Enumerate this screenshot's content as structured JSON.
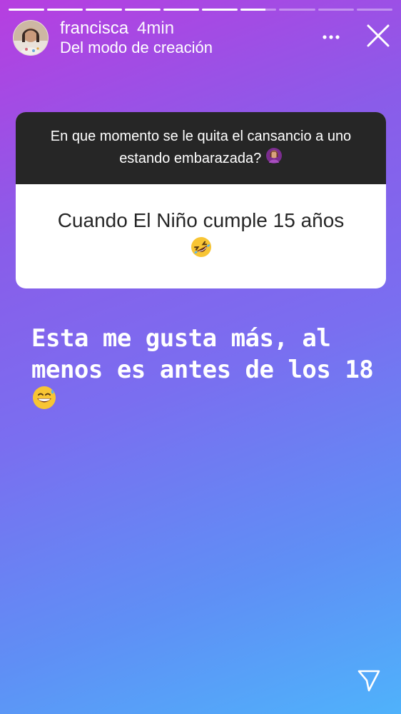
{
  "progress": {
    "segments": 10,
    "completed": 6,
    "current_fraction": 0.7
  },
  "header": {
    "username": "francisca",
    "time": "4min",
    "subtitle": "Del modo de creación",
    "icons": [
      "more-icon",
      "close-icon"
    ]
  },
  "question_card": {
    "question": "En que momento se le quita el cansancio a uno estando embarazada?",
    "question_emoji": "woman-facepalming-emoji",
    "answer": "Cuando El Niño cumple 15 años",
    "answer_emoji": "rolling-on-floor-laughing-emoji"
  },
  "caption": {
    "line1": "Esta me gusta más, al",
    "line2": "menos es antes de los 18",
    "emoji": "grinning-sweat-emoji"
  },
  "footer": {
    "icons": [
      "send-icon"
    ]
  },
  "colors": {
    "gradient_top": "#b73ee0",
    "gradient_bottom": "#4fb2fb",
    "card_question_bg": "#262626",
    "card_answer_bg": "#ffffff"
  }
}
